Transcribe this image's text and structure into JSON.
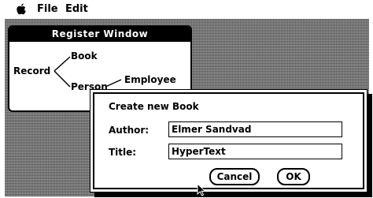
{
  "menubar": {
    "apple_icon": "apple-icon",
    "items": [
      "File",
      "Edit"
    ]
  },
  "register_window": {
    "title": "Register Window",
    "root": "Record",
    "children": [
      "Book",
      "Person"
    ],
    "grandchild": "Employee"
  },
  "dialog": {
    "title": "Create new Book",
    "fields": [
      {
        "label": "Author:",
        "value": "Elmer Sandvad"
      },
      {
        "label": "Title:",
        "value": "HyperText"
      }
    ],
    "buttons": {
      "cancel": "Cancel",
      "ok": "OK"
    }
  },
  "colors": {
    "foreground": "#000000",
    "background": "#ffffff",
    "desktop": "#808080"
  },
  "cursor_icon": "arrow-pointer-icon"
}
